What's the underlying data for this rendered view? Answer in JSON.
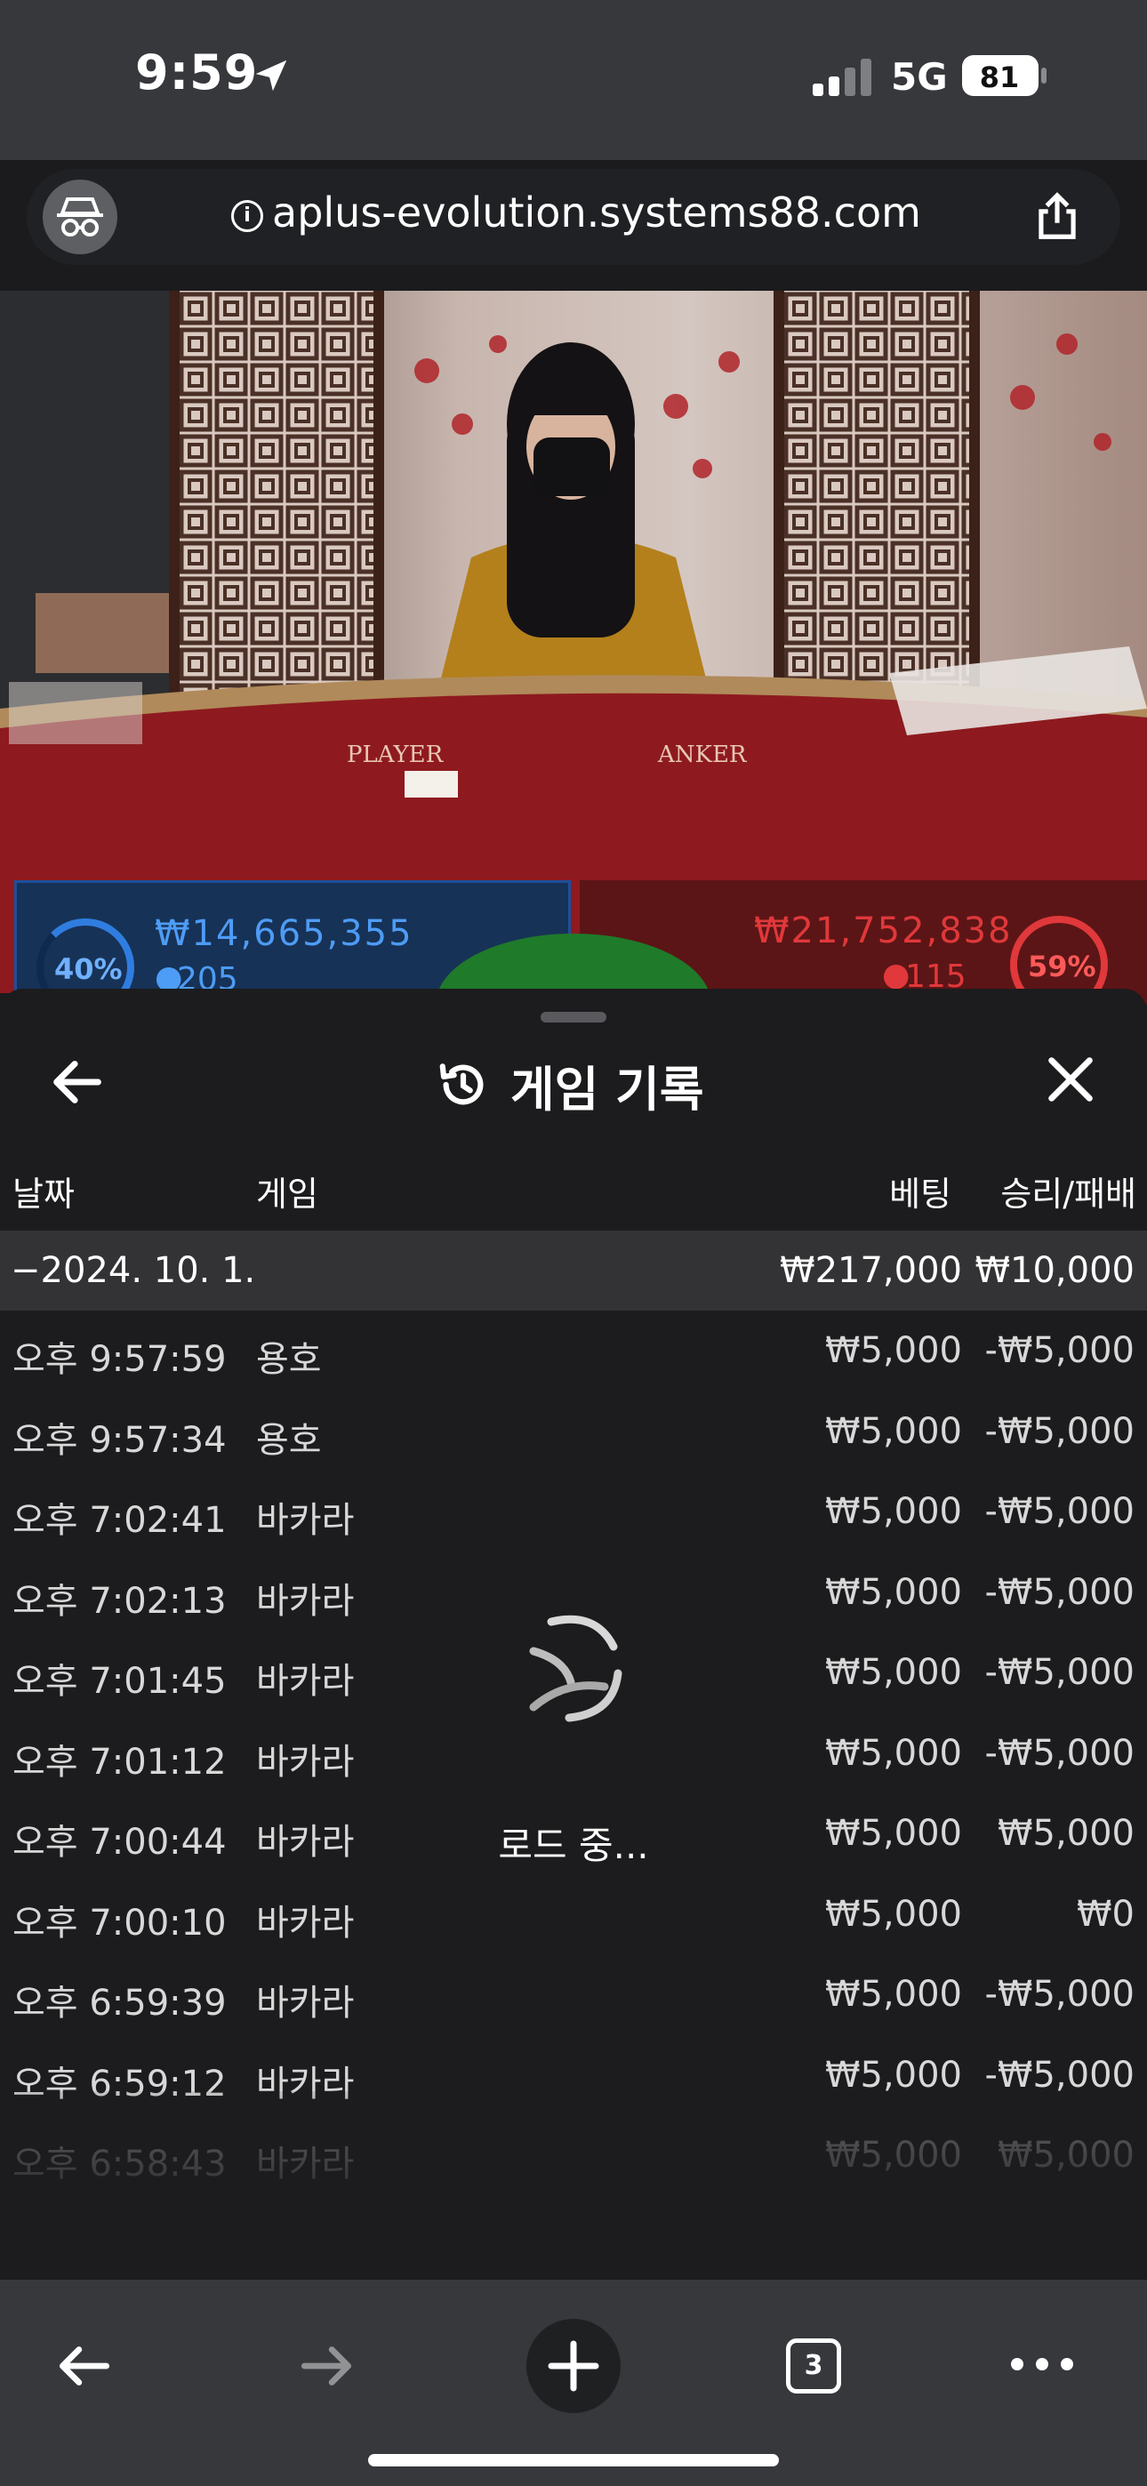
{
  "status_bar": {
    "time": "9:59",
    "network": "5G",
    "battery": "81"
  },
  "browser": {
    "url": "aplus-evolution.systems88.com",
    "tab_count": "3"
  },
  "table_hud": {
    "player_percent": "40%",
    "player_amount": "₩14,665,355",
    "player_count": "205",
    "banker_amount": "₩21,752,838",
    "banker_count": "115",
    "banker_percent": "59%"
  },
  "sheet": {
    "title": "게임 기록",
    "columns": {
      "date": "날짜",
      "game": "게임",
      "bet": "베팅",
      "win_loss": "승리/패배"
    },
    "group": {
      "date": "−2024. 10. 1.",
      "bet": "₩217,000",
      "win_loss": "₩10,000"
    },
    "rows": [
      {
        "time": "오후 9:57:59",
        "game": "용호",
        "bet": "₩5,000",
        "result": "-₩5,000"
      },
      {
        "time": "오후 9:57:34",
        "game": "용호",
        "bet": "₩5,000",
        "result": "-₩5,000"
      },
      {
        "time": "오후 7:02:41",
        "game": "바카라",
        "bet": "₩5,000",
        "result": "-₩5,000"
      },
      {
        "time": "오후 7:02:13",
        "game": "바카라",
        "bet": "₩5,000",
        "result": "-₩5,000"
      },
      {
        "time": "오후 7:01:45",
        "game": "바카라",
        "bet": "₩5,000",
        "result": "-₩5,000"
      },
      {
        "time": "오후 7:01:12",
        "game": "바카라",
        "bet": "₩5,000",
        "result": "-₩5,000"
      },
      {
        "time": "오후 7:00:44",
        "game": "바카라",
        "bet": "₩5,000",
        "result": "₩5,000"
      },
      {
        "time": "오후 7:00:10",
        "game": "바카라",
        "bet": "₩5,000",
        "result": "₩0"
      },
      {
        "time": "오후 6:59:39",
        "game": "바카라",
        "bet": "₩5,000",
        "result": "-₩5,000"
      },
      {
        "time": "오후 6:59:12",
        "game": "바카라",
        "bet": "₩5,000",
        "result": "-₩5,000"
      },
      {
        "time": "오후 6:58:43",
        "game": "바카라",
        "bet": "₩5,000",
        "result": "₩5,000"
      }
    ],
    "loading_text": "로드 중..."
  },
  "icons": {
    "location": "location-arrow-icon",
    "incognito": "incognito-icon",
    "info": "info-icon",
    "share": "share-icon",
    "back": "arrow-left-icon",
    "history": "history-icon",
    "close": "close-icon",
    "loader": "loading-spinner-icon",
    "new_tab": "plus-icon",
    "tabs": "tabs-icon",
    "more": "more-dots-icon"
  }
}
